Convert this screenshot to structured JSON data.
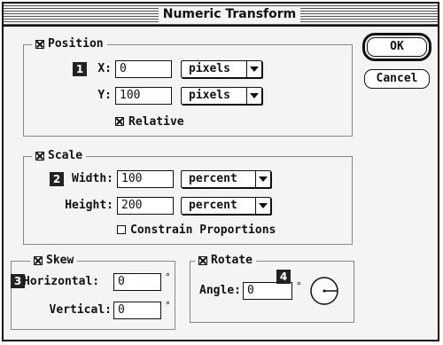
{
  "dialog": {
    "title": "Numeric Transform"
  },
  "buttons": {
    "ok": "OK",
    "cancel": "Cancel"
  },
  "position": {
    "label": "Position",
    "checked": true,
    "x_label": "X:",
    "x_value": "0",
    "x_unit": "pixels",
    "y_label": "Y:",
    "y_value": "100",
    "y_unit": "pixels",
    "relative_label": "Relative",
    "relative_checked": true
  },
  "scale": {
    "label": "Scale",
    "checked": true,
    "width_label": "Width:",
    "width_value": "100",
    "width_unit": "percent",
    "height_label": "Height:",
    "height_value": "200",
    "height_unit": "percent",
    "constrain_label": "Constrain Proportions",
    "constrain_checked": false
  },
  "skew": {
    "label": "Skew",
    "checked": true,
    "horizontal_label": "Horizontal:",
    "horizontal_value": "0",
    "vertical_label": "Vertical:",
    "vertical_value": "0",
    "degree_symbol": "°"
  },
  "rotate": {
    "label": "Rotate",
    "checked": true,
    "angle_label": "Angle:",
    "angle_value": "0",
    "degree_symbol": "°",
    "dial_icon": "angle-dial-icon"
  },
  "callouts": {
    "one": "1",
    "two": "2",
    "three": "3",
    "four": "4"
  }
}
